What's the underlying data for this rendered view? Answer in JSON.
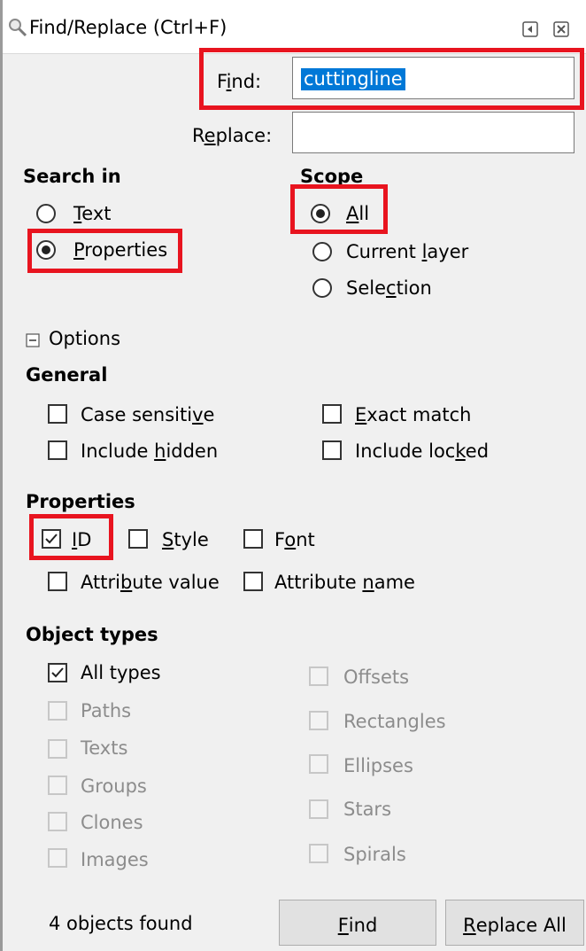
{
  "window": {
    "title": "Find/Replace (Ctrl+F)",
    "icons": [
      "magnifier-icon",
      "panel-dock-icon",
      "close-icon"
    ]
  },
  "find": {
    "label_pre": "F",
    "label_ul": "i",
    "label_post": "nd:",
    "value": "cuttingline"
  },
  "replace": {
    "label_pre": "R",
    "label_ul": "e",
    "label_post": "place:",
    "value": ""
  },
  "search_in": {
    "heading": "Search in",
    "text": {
      "pre": "",
      "ul": "T",
      "post": "ext",
      "selected": false
    },
    "properties": {
      "pre": "",
      "ul": "P",
      "post": "roperties",
      "selected": true
    }
  },
  "scope": {
    "heading": "Scope",
    "all": {
      "pre": "",
      "ul": "A",
      "post": "ll",
      "selected": true
    },
    "current_layer": {
      "pre": "Current ",
      "ul": "l",
      "post": "ayer",
      "selected": false
    },
    "selection": {
      "pre": "Sele",
      "ul": "c",
      "post": "tion",
      "selected": false
    }
  },
  "options": {
    "toggle_icon": "minus-square-icon",
    "label": "Options"
  },
  "general": {
    "heading": "General",
    "case_sensitive": {
      "pre": "Case sensiti",
      "ul": "v",
      "post": "e",
      "checked": false
    },
    "exact_match": {
      "pre": "",
      "ul": "E",
      "post": "xact match",
      "checked": false
    },
    "include_hidden": {
      "pre": "Include ",
      "ul": "h",
      "post": "idden",
      "checked": false
    },
    "include_locked": {
      "pre": "Include loc",
      "ul": "k",
      "post": "ed",
      "checked": false
    }
  },
  "properties": {
    "heading": "Properties",
    "id": {
      "pre": "",
      "ul": "I",
      "post": "D",
      "checked": true
    },
    "style": {
      "pre": "",
      "ul": "S",
      "post": "tyle",
      "checked": false
    },
    "font": {
      "pre": "F",
      "ul": "o",
      "post": "nt",
      "checked": false
    },
    "attribute_value": {
      "pre": "Attri",
      "ul": "b",
      "post": "ute value",
      "checked": false
    },
    "attribute_name": {
      "pre": "Attribute ",
      "ul": "n",
      "post": "ame",
      "checked": false
    }
  },
  "object_types": {
    "heading": "Object types",
    "all_types": {
      "label": "All types",
      "checked": true
    },
    "paths": "Paths",
    "texts": "Texts",
    "groups": "Groups",
    "clones": "Clones",
    "images": "Images",
    "offsets": "Offsets",
    "rectangles": "Rectangles",
    "ellipses": "Ellipses",
    "stars": "Stars",
    "spirals": "Spirals"
  },
  "footer": {
    "status": "4 objects found",
    "find_button": {
      "pre": "",
      "ul": "F",
      "post": "ind"
    },
    "replace_all_button": {
      "pre": "",
      "ul": "R",
      "post": "eplace All"
    }
  },
  "colors": {
    "highlight": "#e8141f",
    "selection": "#0078d7",
    "panel_bg": "#f0f0f0"
  }
}
